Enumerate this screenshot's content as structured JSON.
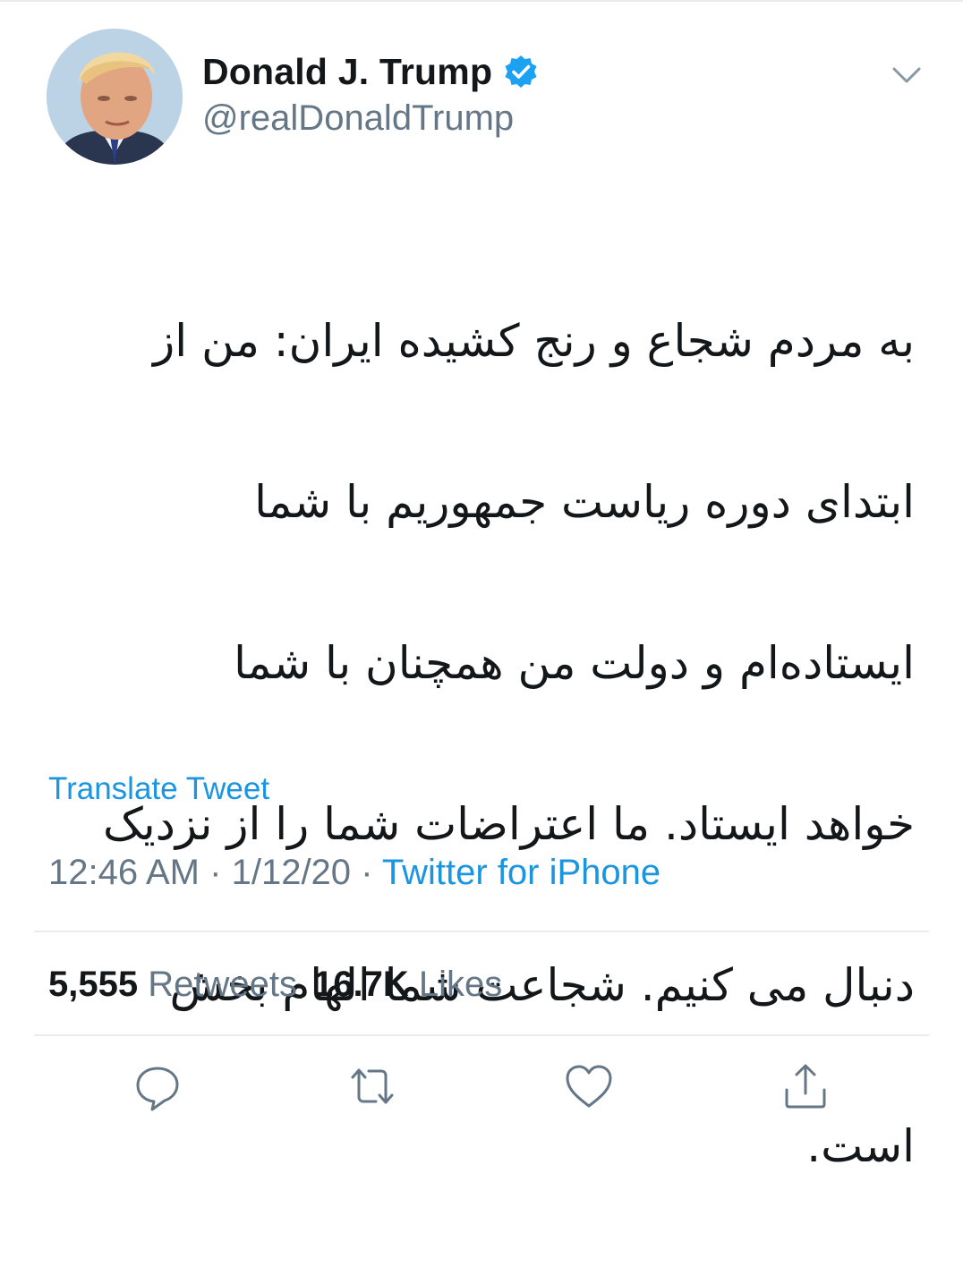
{
  "author": {
    "display_name": "Donald J. Trump",
    "handle": "@realDonaldTrump",
    "verified": true
  },
  "tweet": {
    "lines": [
      "به مردم شجاع و رنج کشیده ایران: من از",
      "ابتدای دوره ریاست جمهوریم با شما",
      "ایستاده‌ام و دولت من همچنان با شما",
      "خواهد ایستاد. ما اعتراضات شما را از نزدیک",
      "دنبال می کنیم. شجاعت شما الهام بخش",
      "است."
    ],
    "translate_label": "Translate Tweet"
  },
  "meta": {
    "time": "12:46 AM",
    "separator": "·",
    "date": "1/12/20",
    "source": "Twitter for iPhone"
  },
  "stats": {
    "retweets_count": "5,555",
    "retweets_label": "Retweets",
    "likes_count": "16.7K",
    "likes_label": "Likes"
  },
  "actions": [
    "reply-icon",
    "retweet-icon",
    "like-icon",
    "share-icon"
  ],
  "colors": {
    "link": "#1b95e0",
    "secondary_text": "#657786",
    "primary_text": "#14171a",
    "divider": "#e6ecf0",
    "verified": "#1da1f2"
  }
}
